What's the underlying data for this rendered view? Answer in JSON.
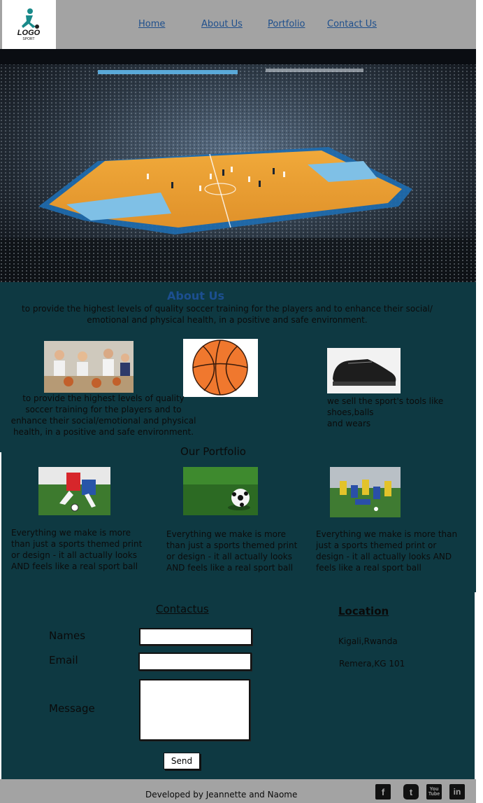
{
  "header": {
    "logo_text": "LOGO",
    "logo_sub": "SPORT",
    "nav": [
      "Home",
      "About Us",
      "Portfolio",
      "Contact Us"
    ]
  },
  "about": {
    "title": "About Us",
    "text": "to provide the highest levels of quality soccer training for the players and to enhance their social/ emotional and physical health, in a positive and safe environment."
  },
  "features": {
    "col1": "to provide the highest levels of quality soccer training for the players and to enhance their social/emotional and physical health, in a positive and safe environment.",
    "col3_line1": "we sell the sport's tools like",
    "col3_line2": "shoes,balls",
    "col3_line3": "and wears"
  },
  "portfolio": {
    "title": "Our Portfolio",
    "items": [
      "Everything we make is more than just a sports themed print or design - it all actually looks AND feels like a real sport ball",
      "Everything we make is more than just a sports themed print or design - it all actually looks AND feels like a real sport ball",
      "Everything we make is more than just a sports themed print or design - it all actually looks AND feels like a real sport ball"
    ]
  },
  "contact": {
    "title": "Contactus",
    "names_label": "Names",
    "email_label": "Email",
    "message_label": "Message",
    "send_label": "Send"
  },
  "location": {
    "title": "Location",
    "line1": "Kigali,Rwanda",
    "line2": "Remera,KG 101"
  },
  "footer": {
    "credit": "Developed by Jeannette and Naome",
    "social": [
      "f",
      "t",
      "You Tube",
      "in"
    ]
  },
  "colors": {
    "panel": "#0e3942",
    "header": "#a3a3a3",
    "nav_link": "#1e4f8c",
    "about_title": "#1c4f90"
  }
}
